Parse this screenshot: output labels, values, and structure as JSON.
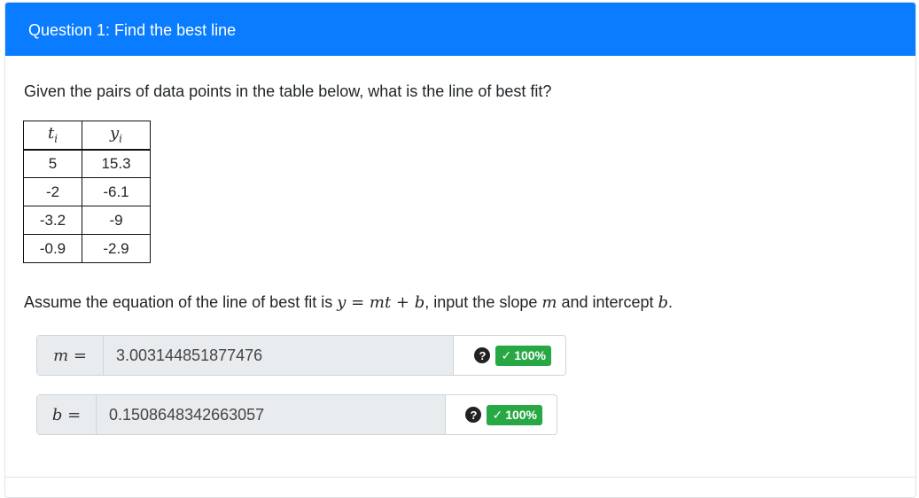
{
  "header": {
    "title": "Question 1: Find the best line"
  },
  "prompt": "Given the pairs of data points in the table below, what is the line of best fit?",
  "table": {
    "col1_header": "t",
    "col1_sub": "i",
    "col2_header": "y",
    "col2_sub": "i",
    "rows": [
      [
        "5",
        "15.3"
      ],
      [
        "-2",
        "-6.1"
      ],
      [
        "-3.2",
        "-9"
      ],
      [
        "-0.9",
        "-2.9"
      ]
    ]
  },
  "assume": {
    "prefix": "Assume the equation of the line of best fit is ",
    "equation": "y = mt + b",
    "middle": ", input the slope ",
    "slope_var": "m",
    "and": " and intercept ",
    "intercept_var": "b",
    "end": "."
  },
  "inputs": {
    "m": {
      "label": "m =",
      "value": "3.003144851877476",
      "score": "100%"
    },
    "b": {
      "label": "b =",
      "value": "0.1508648342663057",
      "score": "100%"
    }
  },
  "icons": {
    "help": "question-circle-icon",
    "check": "check-icon"
  },
  "colors": {
    "header_bg": "#0a7cff",
    "badge_success": "#28a745"
  }
}
